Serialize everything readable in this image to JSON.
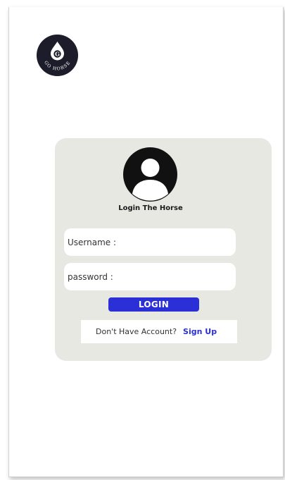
{
  "logo": {
    "text": "GO HORSE",
    "icon": "horse-drop-logo-icon"
  },
  "login_card": {
    "avatar_icon": "user-avatar-icon",
    "title": "Login The Horse",
    "username_label": "Username :",
    "password_label": "password :",
    "login_button": "LOGIN",
    "signup_question": "Don't Have Account?",
    "signup_link": "Sign Up"
  },
  "colors": {
    "accent": "#2a2fd6",
    "card_background": "#e7e8e2",
    "logo_background": "#1c1c2a"
  }
}
